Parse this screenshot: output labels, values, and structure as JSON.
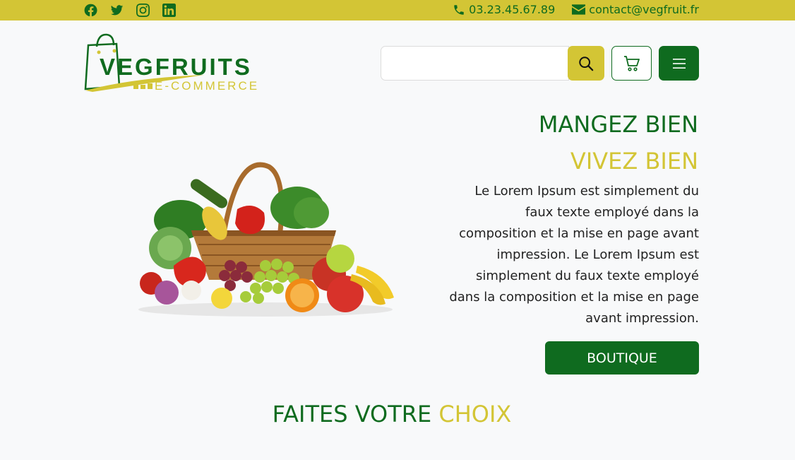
{
  "topbar": {
    "social": [
      {
        "name": "facebook-icon"
      },
      {
        "name": "twitter-icon"
      },
      {
        "name": "instagram-icon"
      },
      {
        "name": "linkedin-icon"
      }
    ],
    "phone": "03.23.45.67.89",
    "email": "contact@vegfruit.fr"
  },
  "header": {
    "logo_brand": "VEGFRUITS",
    "logo_tagline": "E-COMMERCE",
    "search_placeholder": "",
    "search_icon": "search-icon",
    "cart_icon": "cart-icon",
    "menu_icon": "hamburger-icon"
  },
  "hero": {
    "title_line1": "MANGEZ BIEN",
    "title_line2": "VIVEZ BIEN",
    "text": "Le Lorem Ipsum est simplement du faux texte employé dans la composition et la mise en page avant impression. Le Lorem Ipsum est simplement du faux texte employé dans la composition et la mise en page avant impression.",
    "button_label": "BOUTIQUE",
    "image": "vegetable-fruit-basket"
  },
  "section": {
    "title_part1": "FAITES VOTRE",
    "title_part2": "CHOIX"
  },
  "colors": {
    "green": "#0f6b1f",
    "yellow": "#d3c535",
    "background": "#f8f9fa"
  }
}
